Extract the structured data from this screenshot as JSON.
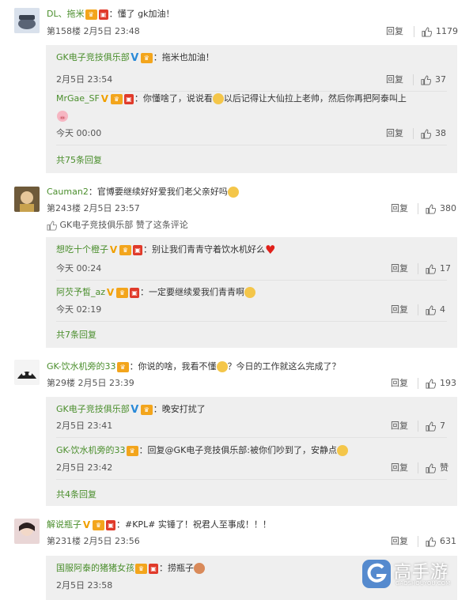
{
  "comments": [
    {
      "username": "DL、拖米",
      "text": "：懂了 gk加油！",
      "floor": "第158楼",
      "time": "2月5日 23:48",
      "reply_label": "回复",
      "likes": "1179",
      "replies": [
        {
          "username": "GK电子竞技俱乐部",
          "text": "：拖米也加油！",
          "time": "2月5日 23:54",
          "reply_label": "回复",
          "likes": "37"
        },
        {
          "username": "MrGae_SF",
          "text": "：你懂啥了，说说看",
          "text2": "以后记得让大仙拉上老帅，然后你再把阿泰叫上",
          "time": "今天 00:00",
          "reply_label": "回复",
          "likes": "38"
        }
      ],
      "more": "共75条回复"
    },
    {
      "username": "Cauman2",
      "text": "：官博要继续好好爱我们老父亲好吗",
      "floor": "第243楼",
      "time": "2月5日 23:57",
      "reply_label": "回复",
      "likes": "380",
      "liked_by": "GK电子竞技俱乐部 赞了这条评论",
      "replies": [
        {
          "username": "想吃十个橙子",
          "text": "：别让我们青青守着饮水机好么",
          "time": "今天 00:24",
          "reply_label": "回复",
          "likes": "17"
        },
        {
          "username": "阿芡予皙_az",
          "text": "：一定要继续爱我们青青啊",
          "time": "今天 02:19",
          "reply_label": "回复",
          "likes": "4"
        }
      ],
      "more": "共7条回复"
    },
    {
      "username": "GK-饮水机旁的33",
      "text": "：你说的啥，我看不懂",
      "text2": "？今日的工作就这么完成了？",
      "floor": "第29楼",
      "time": "2月5日 23:39",
      "reply_label": "回复",
      "likes": "193",
      "replies": [
        {
          "username": "GK电子竞技俱乐部",
          "text": "：晚安打扰了",
          "time": "2月5日 23:41",
          "reply_label": "回复",
          "likes": "7"
        },
        {
          "username": "GK-饮水机旁的33",
          "text": "：回复@GK电子竞技俱乐部:被你们吵到了，安静点",
          "time": "2月5日 23:42",
          "reply_label": "回复",
          "likes": "赞"
        }
      ],
      "more": "共4条回复"
    },
    {
      "username": "解说瓶子",
      "text": "：#KPL# 实锤了！祝君人至事成！！！",
      "floor": "第231楼",
      "time": "2月5日 23:56",
      "reply_label": "回复",
      "likes": "631",
      "replies": [
        {
          "username": "国服阿泰的猪猪女孩",
          "text": "：捞瓶子",
          "time": "2月5日 23:58",
          "reply_label": "回复"
        }
      ]
    }
  ],
  "watermark": {
    "name": "高手游",
    "domain": "GAOSHOUYOU.COM"
  },
  "colors": {
    "username": "#4a8e2c",
    "reply_bg": "#efefef",
    "text": "#333333"
  }
}
